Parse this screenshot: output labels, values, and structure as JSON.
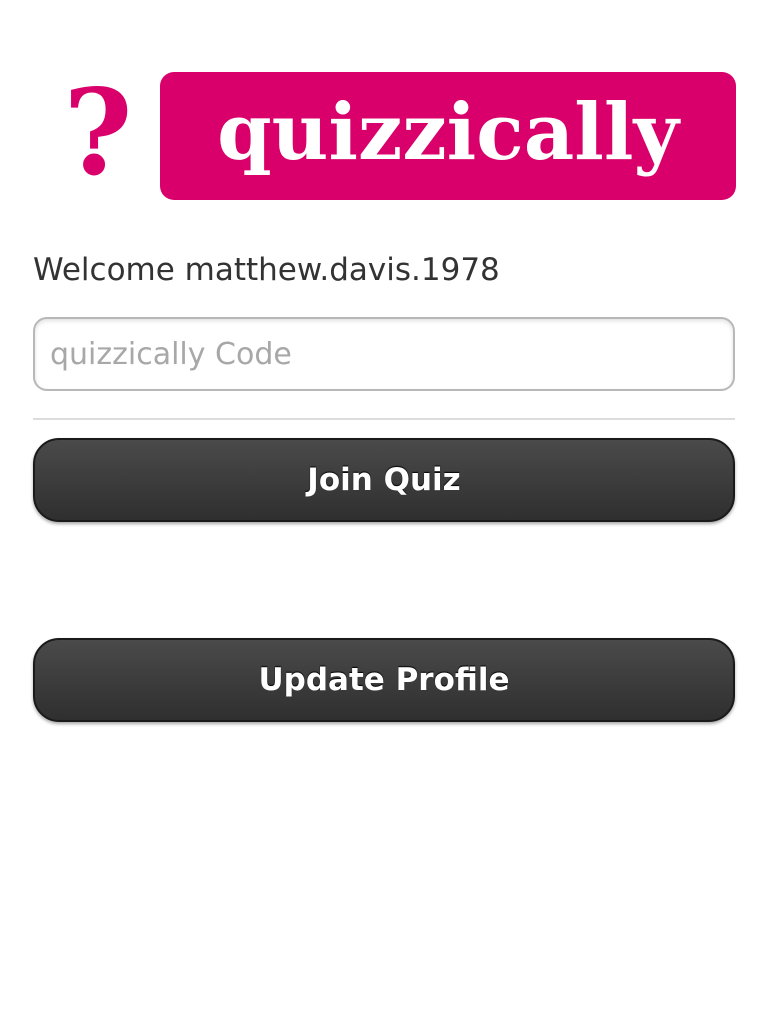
{
  "brand": {
    "question_mark": "?",
    "name": "quizzically",
    "color": "#d9006c"
  },
  "welcome": {
    "text": "Welcome matthew.davis.1978"
  },
  "code_input": {
    "value": "",
    "placeholder": "quizzically Code"
  },
  "buttons": {
    "join_label": "Join Quiz",
    "profile_label": "Update Profile"
  }
}
